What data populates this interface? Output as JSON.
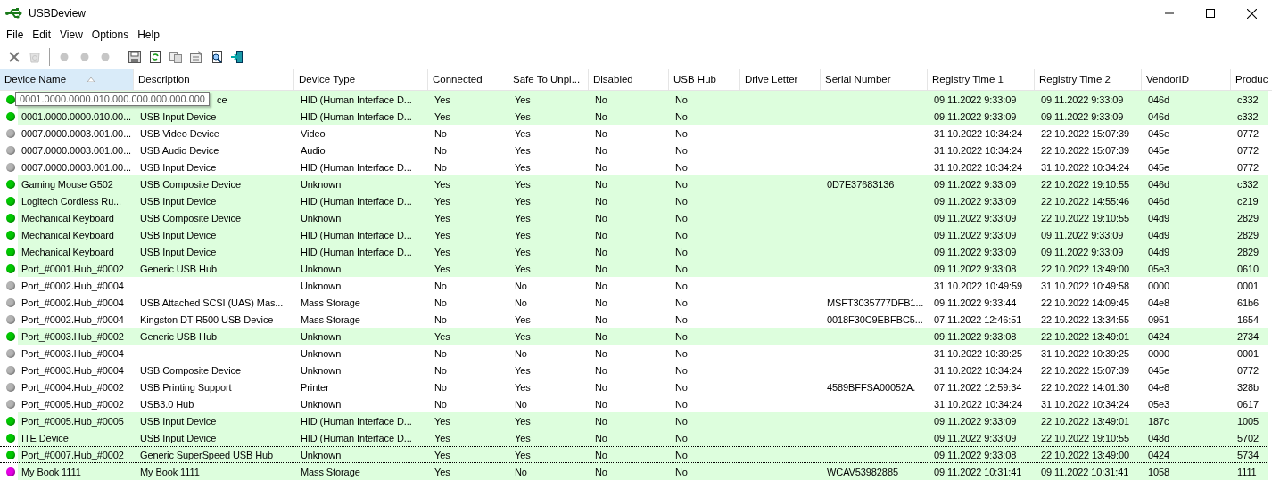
{
  "window": {
    "title": "USBDeview"
  },
  "menu": [
    "File",
    "Edit",
    "View",
    "Options",
    "Help"
  ],
  "toolbar": [
    {
      "kind": "delete",
      "disabled": false
    },
    {
      "kind": "recycle",
      "disabled": true
    },
    {
      "kind": "sep"
    },
    {
      "kind": "dot",
      "disabled": true
    },
    {
      "kind": "dot",
      "disabled": true
    },
    {
      "kind": "dot",
      "disabled": true
    },
    {
      "kind": "sep"
    },
    {
      "kind": "save",
      "disabled": false
    },
    {
      "kind": "refresh",
      "disabled": false
    },
    {
      "kind": "copy",
      "disabled": false
    },
    {
      "kind": "properties",
      "disabled": false
    },
    {
      "kind": "find",
      "disabled": false
    },
    {
      "kind": "exit",
      "disabled": false
    }
  ],
  "table": {
    "columns": [
      {
        "label": "Device Name",
        "sorted": true
      },
      {
        "label": "Description",
        "sorted": false
      },
      {
        "label": "Device Type",
        "sorted": false
      },
      {
        "label": "Connected",
        "sorted": false
      },
      {
        "label": "Safe To Unpl...",
        "sorted": false
      },
      {
        "label": "Disabled",
        "sorted": false
      },
      {
        "label": "USB Hub",
        "sorted": false
      },
      {
        "label": "Drive Letter",
        "sorted": false
      },
      {
        "label": "Serial Number",
        "sorted": false
      },
      {
        "label": "Registry Time 1",
        "sorted": false
      },
      {
        "label": "Registry Time 2",
        "sorted": false
      },
      {
        "label": "VendorID",
        "sorted": false
      },
      {
        "label": "Produc",
        "sorted": false
      }
    ],
    "tooltip": "0001.0000.0000.010.000.000.000.000.000",
    "rows": [
      {
        "color": "#00c800",
        "highlighted": true,
        "focused": false,
        "covered": true,
        "cells": [
          "",
          "ce",
          "HID (Human Interface D...",
          "Yes",
          "Yes",
          "No",
          "No",
          "",
          "",
          "09.11.2022 9:33:09",
          "09.11.2022 9:33:09",
          "046d",
          "c332"
        ]
      },
      {
        "color": "#00c800",
        "highlighted": true,
        "focused": false,
        "covered": false,
        "cells": [
          "0001.0000.0000.010.00...",
          "USB Input Device",
          "HID (Human Interface D...",
          "Yes",
          "Yes",
          "No",
          "No",
          "",
          "",
          "09.11.2022 9:33:09",
          "09.11.2022 9:33:09",
          "046d",
          "c332"
        ]
      },
      {
        "color": "#b4b4b4",
        "highlighted": false,
        "focused": false,
        "covered": false,
        "cells": [
          "0007.0000.0003.001.00...",
          "USB Video Device",
          "Video",
          "No",
          "Yes",
          "No",
          "No",
          "",
          "",
          "31.10.2022 10:34:24",
          "22.10.2022 15:07:39",
          "045e",
          "0772"
        ]
      },
      {
        "color": "#b4b4b4",
        "highlighted": false,
        "focused": false,
        "covered": false,
        "cells": [
          "0007.0000.0003.001.00...",
          "USB Audio Device",
          "Audio",
          "No",
          "Yes",
          "No",
          "No",
          "",
          "",
          "31.10.2022 10:34:24",
          "22.10.2022 15:07:39",
          "045e",
          "0772"
        ]
      },
      {
        "color": "#b4b4b4",
        "highlighted": false,
        "focused": false,
        "covered": false,
        "cells": [
          "0007.0000.0003.001.00...",
          "USB Input Device",
          "HID (Human Interface D...",
          "No",
          "Yes",
          "No",
          "No",
          "",
          "",
          "31.10.2022 10:34:24",
          "31.10.2022 10:34:24",
          "045e",
          "0772"
        ]
      },
      {
        "color": "#00c800",
        "highlighted": true,
        "focused": false,
        "covered": false,
        "cells": [
          "Gaming Mouse G502",
          "USB Composite Device",
          "Unknown",
          "Yes",
          "Yes",
          "No",
          "No",
          "",
          "0D7E37683136",
          "09.11.2022 9:33:09",
          "22.10.2022 19:10:55",
          "046d",
          "c332"
        ]
      },
      {
        "color": "#00c800",
        "highlighted": true,
        "focused": false,
        "covered": false,
        "cells": [
          "Logitech Cordless Ru...",
          "USB Input Device",
          "HID (Human Interface D...",
          "Yes",
          "Yes",
          "No",
          "No",
          "",
          "",
          "09.11.2022 9:33:09",
          "22.10.2022 14:55:46",
          "046d",
          "c219"
        ]
      },
      {
        "color": "#00c800",
        "highlighted": true,
        "focused": false,
        "covered": false,
        "cells": [
          "Mechanical Keyboard",
          "USB Composite Device",
          "Unknown",
          "Yes",
          "Yes",
          "No",
          "No",
          "",
          "",
          "09.11.2022 9:33:09",
          "22.10.2022 19:10:55",
          "04d9",
          "2829"
        ]
      },
      {
        "color": "#00c800",
        "highlighted": true,
        "focused": false,
        "covered": false,
        "cells": [
          "Mechanical Keyboard",
          "USB Input Device",
          "HID (Human Interface D...",
          "Yes",
          "Yes",
          "No",
          "No",
          "",
          "",
          "09.11.2022 9:33:09",
          "09.11.2022 9:33:09",
          "04d9",
          "2829"
        ]
      },
      {
        "color": "#00c800",
        "highlighted": true,
        "focused": false,
        "covered": false,
        "cells": [
          "Mechanical Keyboard",
          "USB Input Device",
          "HID (Human Interface D...",
          "Yes",
          "Yes",
          "No",
          "No",
          "",
          "",
          "09.11.2022 9:33:09",
          "09.11.2022 9:33:09",
          "04d9",
          "2829"
        ]
      },
      {
        "color": "#00c800",
        "highlighted": true,
        "focused": false,
        "covered": false,
        "cells": [
          "Port_#0001.Hub_#0002",
          "Generic USB Hub",
          "Unknown",
          "Yes",
          "Yes",
          "No",
          "No",
          "",
          "",
          "09.11.2022 9:33:08",
          "22.10.2022 13:49:00",
          "05e3",
          "0610"
        ]
      },
      {
        "color": "#b4b4b4",
        "highlighted": false,
        "focused": false,
        "cells": [
          "Port_#0002.Hub_#0004",
          "",
          "Unknown",
          "No",
          "No",
          "No",
          "No",
          "",
          "",
          "31.10.2022 10:49:59",
          "31.10.2022 10:49:58",
          "0000",
          "0001"
        ]
      },
      {
        "color": "#b4b4b4",
        "highlighted": false,
        "focused": false,
        "covered": false,
        "cells": [
          "Port_#0002.Hub_#0004",
          "USB Attached SCSI (UAS) Mas...",
          "Mass Storage",
          "No",
          "No",
          "No",
          "No",
          "",
          "MSFT3035777DFB1...",
          "09.11.2022 9:33:44",
          "22.10.2022 14:09:45",
          "04e8",
          "61b6"
        ]
      },
      {
        "color": "#b4b4b4",
        "highlighted": false,
        "focused": false,
        "covered": false,
        "cells": [
          "Port_#0002.Hub_#0004",
          "Kingston DT R500 USB Device",
          "Mass Storage",
          "No",
          "Yes",
          "No",
          "No",
          "",
          "0018F30C9EBFBC5...",
          "07.11.2022 12:46:51",
          "22.10.2022 13:34:55",
          "0951",
          "1654"
        ]
      },
      {
        "color": "#00c800",
        "highlighted": true,
        "focused": false,
        "covered": false,
        "cells": [
          "Port_#0003.Hub_#0002",
          "Generic USB Hub",
          "Unknown",
          "Yes",
          "Yes",
          "No",
          "No",
          "",
          "",
          "09.11.2022 9:33:08",
          "22.10.2022 13:49:01",
          "0424",
          "2734"
        ]
      },
      {
        "color": "#b4b4b4",
        "highlighted": false,
        "focused": false,
        "cells": [
          "Port_#0003.Hub_#0004",
          "",
          "Unknown",
          "No",
          "No",
          "No",
          "No",
          "",
          "",
          "31.10.2022 10:39:25",
          "31.10.2022 10:39:25",
          "0000",
          "0001"
        ]
      },
      {
        "color": "#b4b4b4",
        "highlighted": false,
        "focused": false,
        "covered": false,
        "cells": [
          "Port_#0003.Hub_#0004",
          "USB Composite Device",
          "Unknown",
          "No",
          "Yes",
          "No",
          "No",
          "",
          "",
          "31.10.2022 10:34:24",
          "22.10.2022 15:07:39",
          "045e",
          "0772"
        ]
      },
      {
        "color": "#b4b4b4",
        "highlighted": false,
        "focused": false,
        "covered": false,
        "cells": [
          "Port_#0004.Hub_#0002",
          "USB Printing Support",
          "Printer",
          "No",
          "Yes",
          "No",
          "No",
          "",
          "4589BFFSA00052A.",
          "07.11.2022 12:59:34",
          "22.10.2022 14:01:30",
          "04e8",
          "328b"
        ]
      },
      {
        "color": "#b4b4b4",
        "highlighted": false,
        "focused": false,
        "covered": false,
        "cells": [
          "Port_#0005.Hub_#0002",
          "USB3.0 Hub",
          "Unknown",
          "No",
          "No",
          "No",
          "No",
          "",
          "",
          "31.10.2022 10:34:24",
          "31.10.2022 10:34:24",
          "05e3",
          "0617"
        ]
      },
      {
        "color": "#00c800",
        "highlighted": true,
        "focused": false,
        "covered": false,
        "cells": [
          "Port_#0005.Hub_#0005",
          "USB Input Device",
          "HID (Human Interface D...",
          "Yes",
          "Yes",
          "No",
          "No",
          "",
          "",
          "09.11.2022 9:33:09",
          "22.10.2022 13:49:01",
          "187c",
          "1005"
        ]
      },
      {
        "color": "#00c800",
        "highlighted": true,
        "focused": false,
        "covered": false,
        "cells": [
          "ITE Device",
          "USB Input Device",
          "HID (Human Interface D...",
          "Yes",
          "Yes",
          "No",
          "No",
          "",
          "",
          "09.11.2022 9:33:09",
          "22.10.2022 19:10:55",
          "048d",
          "5702"
        ]
      },
      {
        "color": "#00c800",
        "highlighted": true,
        "focused": true,
        "covered": false,
        "cells": [
          "Port_#0007.Hub_#0002",
          "Generic SuperSpeed USB Hub",
          "Unknown",
          "Yes",
          "Yes",
          "No",
          "No",
          "",
          "",
          "09.11.2022 9:33:08",
          "22.10.2022 13:49:00",
          "0424",
          "5734"
        ]
      },
      {
        "color": "#e600e6",
        "highlighted": true,
        "focused": false,
        "covered": false,
        "cells": [
          "My Book 1111",
          "My Book 1111",
          "Mass Storage",
          "Yes",
          "No",
          "No",
          "No",
          "",
          "WCAV53982885",
          "09.11.2022 10:31:41",
          "09.11.2022 10:31:41",
          "1058",
          "1111"
        ]
      }
    ]
  }
}
